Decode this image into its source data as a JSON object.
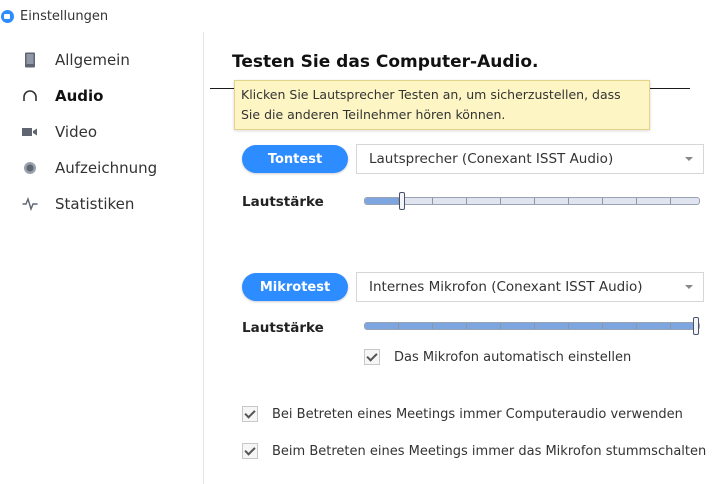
{
  "window": {
    "title": "Einstellungen",
    "logo_icon": "zoom-logo-icon"
  },
  "sidebar": {
    "items": [
      {
        "label": "Allgemein",
        "icon": "phone-icon",
        "active": false
      },
      {
        "label": "Audio",
        "icon": "headphones-icon",
        "active": true
      },
      {
        "label": "Video",
        "icon": "video-camera-icon",
        "active": false
      },
      {
        "label": "Aufzeichnung",
        "icon": "record-icon",
        "active": false
      },
      {
        "label": "Statistiken",
        "icon": "pulse-icon",
        "active": false
      }
    ]
  },
  "main": {
    "title": "Testen Sie das Computer-Audio.",
    "tooltip": "Klicken Sie Lautsprecher Testen an, um sicherzustellen, dass Sie die anderen Teilnehmer hören können.",
    "speaker": {
      "button_label": "Tontest",
      "device": "Lautsprecher (Conexant ISST Audio)",
      "volume_label": "Lautstärke",
      "volume_level": 0.11
    },
    "microphone": {
      "button_label": "Mikrotest",
      "device": "Internes Mikrofon (Conexant ISST Audio)",
      "volume_label": "Lautstärke",
      "volume_level": 1.0,
      "auto_adjust_label": "Das Mikrofon automatisch einstellen",
      "auto_adjust_checked": true
    },
    "options": [
      {
        "label": "Bei Betreten eines Meetings immer Computeraudio verwenden",
        "checked": true
      },
      {
        "label": "Beim Betreten eines Meetings immer das Mikrofon stummschalten",
        "checked": true
      }
    ]
  },
  "colors": {
    "accent": "#2d8cff",
    "tooltip_bg": "#fdf6c4",
    "slider_fill": "#7da5e0"
  }
}
